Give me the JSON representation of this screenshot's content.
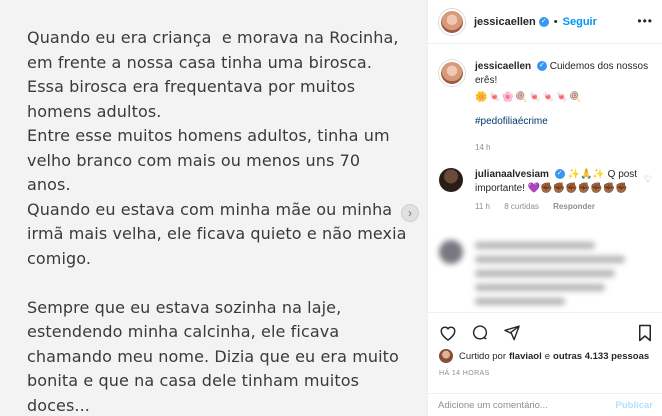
{
  "post": {
    "text": "Quando eu era criança  e morava na Rocinha,\nem frente a nossa casa tinha uma birosca.\nEssa birosca era frequentava por muitos\nhomens adultos.\nEntre esse muitos homens adultos, tinha um\nvelho branco com mais ou menos uns 70\nanos.\nQuando eu estava com minha mãe ou minha\nirmã mais velha, ele ficava quieto e não mexia\ncomigo.\n\nSempre que eu estava sozinha na laje,\nestendendo minha calcinha, ele ficava\nchamando meu nome. Dizia que eu era muito\nbonita e que na casa dele tinham muitos\ndoces...",
    "next_glyph": "›"
  },
  "header": {
    "username": "jessicaellen",
    "separator": "•",
    "follow_label": "Seguir",
    "more_glyph": "•••"
  },
  "caption": {
    "username": "jessicaellen",
    "text": "Cuidemos dos nossos erês!",
    "emojis": "🌼🍬🌸🍭🍬🍬🍬🍭",
    "hashtag": "#pedofiliaécrime",
    "time": "14 h"
  },
  "comment": {
    "username": "julianaalvesiam",
    "text": "✨🙏✨ Q post importante! 💜✊🏾✊🏾✊🏾✊🏾✊🏾✊🏾✊🏾",
    "time": "11 h",
    "likes": "8 curtidas",
    "reply": "Responder"
  },
  "likes": {
    "prefix": "Curtido por",
    "user": "flaviaol",
    "middle": "e",
    "others": "outras 4.133 pessoas"
  },
  "timestamp": "HÁ 14 HORAS",
  "add_comment": {
    "placeholder": "Adicione um comentário...",
    "publish_label": "Publicar"
  },
  "icons": [
    "heart-icon",
    "comment-icon",
    "share-icon",
    "bookmark-icon"
  ],
  "colors": {
    "accent": "#0095f6",
    "link": "#00376b",
    "muted": "#8e8e8e"
  }
}
